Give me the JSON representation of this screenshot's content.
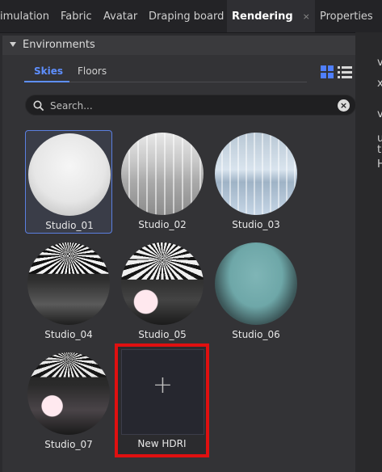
{
  "tabs": [
    {
      "label": "imulation",
      "active": false
    },
    {
      "label": "Fabric",
      "active": false
    },
    {
      "label": "Avatar",
      "active": false
    },
    {
      "label": "Draping board",
      "active": false
    },
    {
      "label": "Rendering",
      "active": true,
      "close": "×"
    },
    {
      "label": "Properties",
      "active": false
    }
  ],
  "section": {
    "title": "Environments"
  },
  "subtabs": [
    {
      "label": "Skies",
      "active": true
    },
    {
      "label": "Floors",
      "active": false
    }
  ],
  "search": {
    "placeholder": "Search..."
  },
  "skies": [
    {
      "label": "Studio_01",
      "selected": true
    },
    {
      "label": "Studio_02",
      "selected": false
    },
    {
      "label": "Studio_03",
      "selected": false
    },
    {
      "label": "Studio_04",
      "selected": false
    },
    {
      "label": "Studio_05",
      "selected": false
    },
    {
      "label": "Studio_06",
      "selected": false
    },
    {
      "label": "Studio_07",
      "selected": false
    }
  ],
  "new_hdri": {
    "label": "New HDRI",
    "plus": "+"
  },
  "right_panel_chars": [
    "v",
    "x",
    "v",
    "u",
    "t",
    "H"
  ],
  "colors": {
    "accent": "#5e8fff",
    "highlight_border": "#e01010"
  }
}
